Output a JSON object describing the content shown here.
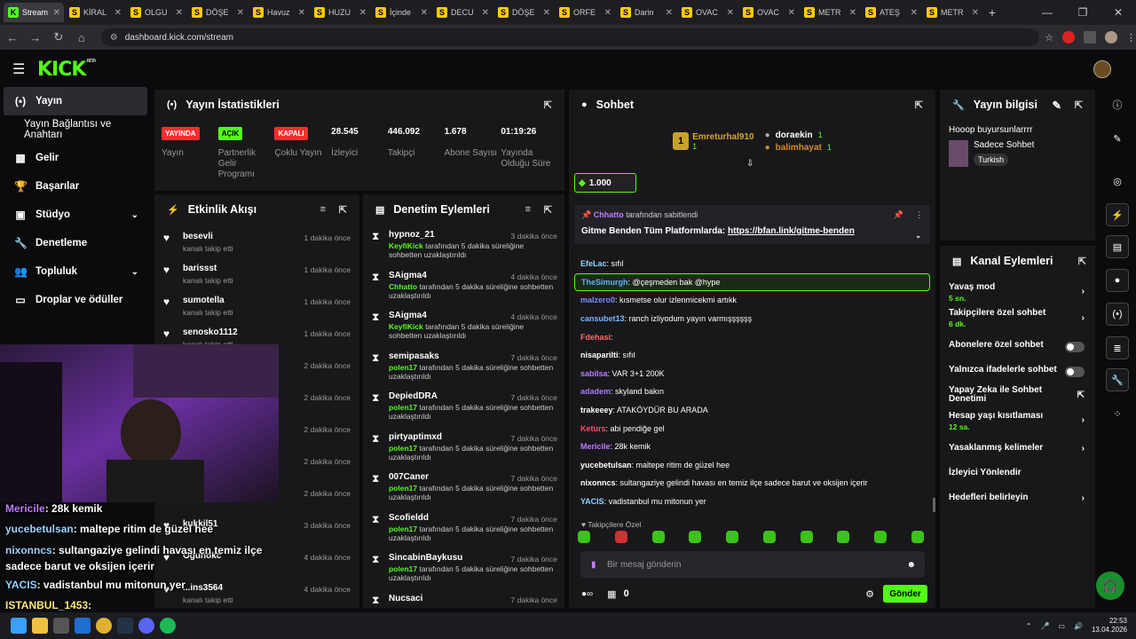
{
  "browser": {
    "tabs": [
      {
        "label": "Stream",
        "fav": "K",
        "active": true
      },
      {
        "label": "KİRAL",
        "fav": "S"
      },
      {
        "label": "OLGU",
        "fav": "S"
      },
      {
        "label": "DÖŞE",
        "fav": "S"
      },
      {
        "label": "Havuz",
        "fav": "S"
      },
      {
        "label": "HUZU",
        "fav": "S"
      },
      {
        "label": "İçinde",
        "fav": "S"
      },
      {
        "label": "DECU",
        "fav": "S"
      },
      {
        "label": "DÖŞE",
        "fav": "S"
      },
      {
        "label": "ORFE",
        "fav": "S"
      },
      {
        "label": "Darin",
        "fav": "S"
      },
      {
        "label": "OVAC",
        "fav": "S"
      },
      {
        "label": "OVAC",
        "fav": "S"
      },
      {
        "label": "METR",
        "fav": "S"
      },
      {
        "label": "ATEŞ",
        "fav": "S"
      },
      {
        "label": "METR",
        "fav": "S"
      }
    ],
    "url": "dashboard.kick.com/stream"
  },
  "logo": "KICK",
  "logo_beta": "BETA",
  "sidenav": [
    {
      "label": "Yayın",
      "icon": "(•)",
      "active": true
    },
    {
      "label": "Yayın Bağlantısı ve Anahtarı",
      "sub": true
    },
    {
      "label": "Gelir",
      "icon": "▦"
    },
    {
      "label": "Başarılar",
      "icon": "🏆"
    },
    {
      "label": "Stüdyo",
      "icon": "▣",
      "chev": true
    },
    {
      "label": "Denetleme",
      "icon": "🔧"
    },
    {
      "label": "Topluluk",
      "icon": "👥",
      "chev": true
    },
    {
      "label": "Droplar ve ödüller",
      "icon": "▭"
    }
  ],
  "stats": {
    "title": "Yayın İstatistikleri",
    "items": [
      {
        "badge": "YAYINDA",
        "badge_color": "red",
        "label": "Yayın"
      },
      {
        "badge": "AÇIK",
        "badge_color": "green",
        "label": "Partnerlik Gelir Programı"
      },
      {
        "badge": "KAPALI",
        "badge_color": "red",
        "label": "Çoklu Yayın"
      },
      {
        "value": "28.545",
        "label": "İzleyici"
      },
      {
        "value": "446.092",
        "label": "Takipçi"
      },
      {
        "value": "1.678",
        "label": "Abone Sayısı"
      },
      {
        "value": "01:19:26",
        "label": "Yayında Olduğu Süre"
      }
    ]
  },
  "feed": {
    "title": "Etkinlik Akışı",
    "items": [
      {
        "name": "besevli",
        "sub": "kanalı takip etti",
        "time": "1 dakika önce"
      },
      {
        "name": "barissst",
        "sub": "kanalı takip etti",
        "time": "1 dakika önce"
      },
      {
        "name": "sumotella",
        "sub": "kanalı takip etti",
        "time": "1 dakika önce"
      },
      {
        "name": "senosko1112",
        "sub": "kanalı takip etti",
        "time": "1 dakika önce"
      },
      {
        "name": "",
        "sub": "",
        "time": "2 dakika önce"
      },
      {
        "name": "",
        "sub": "",
        "time": "2 dakika önce"
      },
      {
        "name": "",
        "sub": "",
        "time": "2 dakika önce"
      },
      {
        "name": "",
        "sub": "",
        "time": "2 dakika önce"
      },
      {
        "name": "",
        "sub": "kanalı takip etti",
        "time": "2 dakika önce"
      },
      {
        "name": "kukkil51",
        "sub": "",
        "time": "3 dakika önce"
      },
      {
        "name": "Ogunokc",
        "sub": "",
        "time": "4 dakika önce"
      },
      {
        "name": "...ins3564",
        "sub": "kanalı takip etti",
        "time": "4 dakika önce"
      }
    ]
  },
  "moderation": {
    "title": "Denetim Eylemleri",
    "items": [
      {
        "name": "hypnoz_21",
        "mod": "KeyfiKick",
        "text": " tarafından 5 dakika süreliğine sohbetten uzaklaştırıldı",
        "time": "3 dakika önce"
      },
      {
        "name": "SAigma4",
        "mod": "Chhatto",
        "text": " tarafından 5 dakika süreliğine sohbetten uzaklaştırıldı",
        "time": "4 dakika önce"
      },
      {
        "name": "SAigma4",
        "mod": "KeyfiKick",
        "text": " tarafından 5 dakika süreliğine sohbetten uzaklaştırıldı",
        "time": "4 dakika önce"
      },
      {
        "name": "semipasaks",
        "mod": "polen17",
        "text": " tarafından 5 dakika süreliğine sohbetten uzaklaştırıldı",
        "time": "7 dakika önce"
      },
      {
        "name": "DepiedDRA",
        "mod": "polen17",
        "text": " tarafından 5 dakika süreliğine sohbetten uzaklaştırıldı",
        "time": "7 dakika önce"
      },
      {
        "name": "pirtyaptimxd",
        "mod": "polen17",
        "text": " tarafından 5 dakika süreliğine sohbetten uzaklaştırıldı",
        "time": "7 dakika önce"
      },
      {
        "name": "007Caner",
        "mod": "polen17",
        "text": " tarafından 5 dakika süreliğine sohbetten uzaklaştırıldı",
        "time": "7 dakika önce"
      },
      {
        "name": "Scofieldd",
        "mod": "polen17",
        "text": " tarafından 5 dakika süreliğine sohbetten uzaklaştırıldı",
        "time": "7 dakika önce"
      },
      {
        "name": "SincabinBaykusu",
        "mod": "polen17",
        "text": " tarafından 5 dakika süreliğine sohbetten uzaklaştırıldı",
        "time": "7 dakika önce"
      },
      {
        "name": "Nucsaci",
        "mod": "",
        "text": "",
        "time": "7 dakika önce"
      }
    ]
  },
  "chat": {
    "title": "Sohbet",
    "leaders": {
      "first_name": "Emreturhal910",
      "first_count": "1",
      "second_name": "doгаekin",
      "second_count": "1",
      "third_name": "balimhayat",
      "third_count": "1"
    },
    "sub_count": "1.000",
    "pinned_by": "Chhatto",
    "pinned_suffix": " tarafından sabitlendi",
    "pinned_text": "Gitme Benden Tüm Platformlarda: ",
    "pinned_link": "https://bfan.link/gitme-benden",
    "messages": [
      {
        "user": "EfeLac",
        "color": "#8fd3ff",
        "text": ": sıfıl"
      },
      {
        "user": "TheSimurgh",
        "color": "#5fb0ff",
        "text": ": @çeşmeden bak @hype",
        "hl": true
      },
      {
        "user": "malzero0",
        "color": "#7b8cff",
        "text": ": kısmetse olur izlenmicekmi artıkk"
      },
      {
        "user": "cansubet13",
        "color": "#7bb4ff",
        "text": ": ranch izliyodum yayın varmışşşşşş"
      },
      {
        "user": "Fdehasi",
        "color": "#ff6b6b",
        "text": ":"
      },
      {
        "user": "nisaparilti",
        "color": "#ffffff",
        "text": ": sıfıl"
      },
      {
        "user": "sabilsa",
        "color": "#c07bff",
        "text": ": VAR 3+1 200K"
      },
      {
        "user": "adadem",
        "color": "#a57bff",
        "text": ": skyland bakın"
      },
      {
        "user": "trakeeey",
        "color": "#ffffff",
        "text": ": ATAKÖYDÜR BU ARADA"
      },
      {
        "user": "Keturs",
        "color": "#ff4b6b",
        "text": ": abi pendiğe gel"
      },
      {
        "user": "Mericile",
        "color": "#c07bff",
        "text": ": 28k kemik"
      },
      {
        "user": "yucebetulsan",
        "color": "#ffffff",
        "text": ": maltepe ritim de güzel hee"
      },
      {
        "user": "nixonncs",
        "color": "#ffffff",
        "text": ": sultangaziye gelindi havası en temiz ilçe sadece barut ve oksijen içerir"
      },
      {
        "user": "YACIS",
        "color": "#8fd3ff",
        "text": ": vadistanbul mu mitonun yer"
      }
    ],
    "followers_only": "Takipçilere Özel",
    "placeholder": "Bir mesaj gönderin",
    "points": "0",
    "send": "Gönder"
  },
  "info": {
    "title": "Yayın bilgisi",
    "stream_title": "Hooop buyursunlarrrr",
    "category": "Sadece Sohbet",
    "tag": "Turkish"
  },
  "actions": {
    "title": "Kanal Eylemleri",
    "items": [
      {
        "label": "Yavaş mod",
        "sub": "5 sn.",
        "kind": "chev"
      },
      {
        "label": "Takipçilere özel sohbet",
        "sub": "6 dk.",
        "kind": "chev"
      },
      {
        "label": "Abonelere özel sohbet",
        "kind": "toggle"
      },
      {
        "label": "Yalnızca ifadelerle sohbet",
        "kind": "toggle"
      },
      {
        "label": "Yapay Zeka ile Sohbet Denetimi",
        "kind": "ext"
      },
      {
        "label": "Hesap yaşı kısıtlaması",
        "sub": "12 sa.",
        "kind": "chev"
      },
      {
        "label": "Yasaklanmış kelimeler",
        "kind": "chev"
      },
      {
        "label": "İzleyici Yönlendir",
        "kind": "none"
      },
      {
        "label": "Hedefleri belirleyin",
        "kind": "chev"
      }
    ]
  },
  "overlay": [
    {
      "user": "Mericile",
      "color": "#c07bff",
      "text": ": 28k kemik"
    },
    {
      "user": "yucebetulsan",
      "color": "#9fd0ff",
      "text": ": maltepe ritim de güzel hee"
    },
    {
      "user": "nixonncs",
      "color": "#9fd0ff",
      "text": ": sultangaziye gelindi havası en temiz ilçe sadece barut ve oksijen içerir"
    },
    {
      "user": "YACIS",
      "color": "#8fd3ff",
      "text": ": vadistanbul mu mitonun yer"
    },
    {
      "user": "ISTANBUL_1453",
      "color": "#ffe87a",
      "text": ":"
    }
  ],
  "taskbar": {
    "time": "22:53",
    "date": "13.04.2026"
  }
}
